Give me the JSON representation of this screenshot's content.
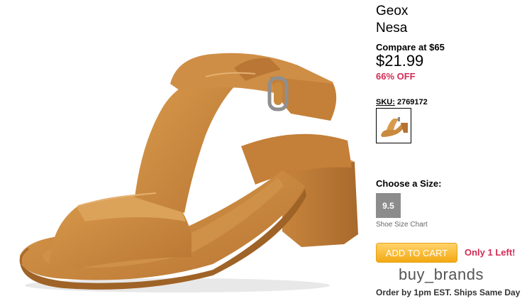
{
  "product": {
    "brand": "Geox",
    "model": "Nesa",
    "compare_text": "Compare at $65",
    "price": "$21.99",
    "discount": "66% OFF",
    "sku_label": "SKU:",
    "sku_value": "2769172"
  },
  "size": {
    "title": "Choose a Size:",
    "options": [
      "9.5"
    ],
    "chart_link": "Shoe Size Chart"
  },
  "cart": {
    "button_label": "ADD TO CART",
    "stock_text": "Only 1 Left!"
  },
  "seller": "buy_brands",
  "shipping_note": "Order by 1pm EST. Ships Same Day",
  "colors": {
    "sandal": "#c98a3e",
    "discount_red": "#d22b55",
    "cart_orange": "#f3a912",
    "size_gray": "#8c8c8c"
  }
}
